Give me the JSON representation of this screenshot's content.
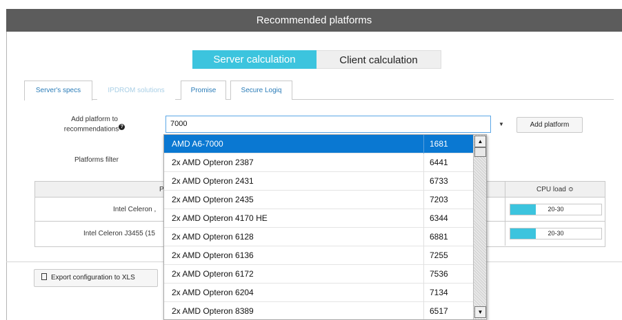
{
  "title": "Recommended platforms",
  "calc_toggle": {
    "server": "Server calculation",
    "client": "Client calculation"
  },
  "tabs": [
    {
      "label": "Server's specs"
    },
    {
      "label": "IPDROM solutions"
    },
    {
      "label": "Promise"
    },
    {
      "label": "Secure Logiq"
    }
  ],
  "form": {
    "add_label": "Add platform to recommendations",
    "help_icon": "?",
    "input_value": "7000",
    "dropdown_arrow": "▼",
    "add_button": "Add platform",
    "filter_label": "Platforms filter"
  },
  "table": {
    "col_platform": "P",
    "col_cpu": "CPU load ≎",
    "rows": [
      {
        "name": "Intel Celeron ,",
        "cpu": "20-30",
        "cpu_fill": 0.28
      },
      {
        "name": "Intel Celeron J3455 (15",
        "cpu": "20-30",
        "cpu_fill": 0.28
      }
    ]
  },
  "export_button": "Export configuration to XLS",
  "dropdown": {
    "items": [
      {
        "name": "AMD A6-7000",
        "value": "1681",
        "selected": true
      },
      {
        "name": "2x AMD Opteron 2387",
        "value": "6441"
      },
      {
        "name": "2x AMD Opteron 2431",
        "value": "6733"
      },
      {
        "name": "2x AMD Opteron 2435",
        "value": "7203"
      },
      {
        "name": "2x AMD Opteron 4170 HE",
        "value": "6344"
      },
      {
        "name": "2x AMD Opteron 6128",
        "value": "6881"
      },
      {
        "name": "2x AMD Opteron 6136",
        "value": "7255"
      },
      {
        "name": "2x AMD Opteron 6172",
        "value": "7536"
      },
      {
        "name": "2x AMD Opteron 6204",
        "value": "7134"
      },
      {
        "name": "2x AMD Opteron 8389",
        "value": "6517"
      }
    ],
    "scroll_up": "▲",
    "scroll_down": "▼"
  }
}
